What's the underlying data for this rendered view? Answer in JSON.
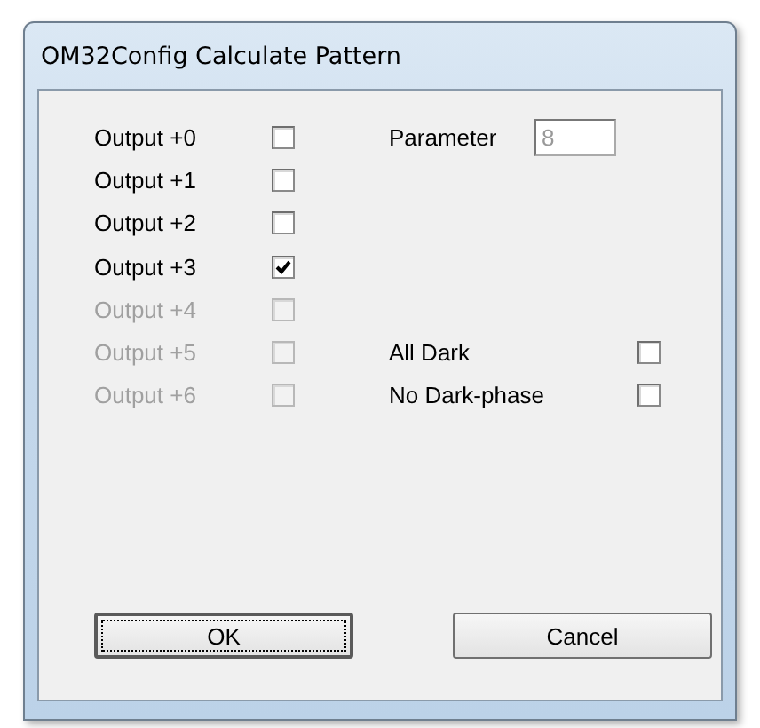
{
  "window": {
    "title": "OM32Config Calculate Pattern"
  },
  "outputs": [
    {
      "label": "Output +0",
      "checked": false,
      "disabled": false
    },
    {
      "label": "Output +1",
      "checked": false,
      "disabled": false
    },
    {
      "label": "Output +2",
      "checked": false,
      "disabled": false
    },
    {
      "label": "Output +3",
      "checked": true,
      "disabled": false
    },
    {
      "label": "Output +4",
      "checked": false,
      "disabled": true
    },
    {
      "label": "Output +5",
      "checked": false,
      "disabled": true
    },
    {
      "label": "Output +6",
      "checked": false,
      "disabled": true
    }
  ],
  "parameter": {
    "label": "Parameter",
    "value": "8",
    "disabled": true
  },
  "options": [
    {
      "label": "All Dark",
      "checked": false,
      "disabled": false
    },
    {
      "label": "No Dark-phase",
      "checked": false,
      "disabled": false
    }
  ],
  "buttons": [
    {
      "label": "OK",
      "focused": true
    },
    {
      "label": "Cancel",
      "focused": false
    }
  ]
}
